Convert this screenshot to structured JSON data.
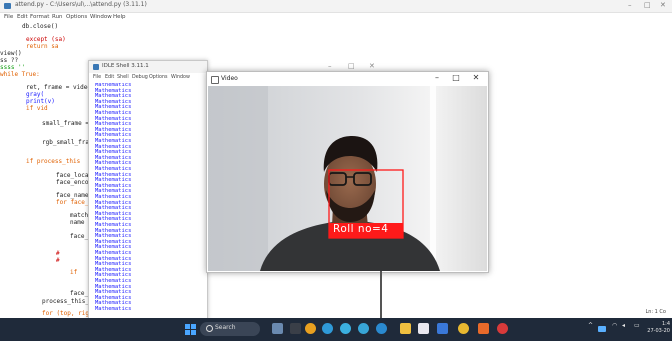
{
  "editor": {
    "title": "attend.py - C:\\Users\\ul\\...\\attend.py (3.11.1)",
    "menu": [
      "File",
      "Edit",
      "Format",
      "Run",
      "Options",
      "Window",
      "Help"
    ],
    "lines": [
      "db.close()",
      "",
      "except (sa)",
      "return sa",
      "view()",
      "ss ??",
      "ssss ''",
      "while True:",
      "",
      "ret, frame = video.read()",
      "gray(",
      "print(v)",
      "if vid",
      "",
      "small_frame = c",
      "",
      "rgb_small_fram",
      "",
      "if process_this",
      "",
      "face_locatio",
      "face_encodin",
      "",
      "face_names =",
      "for face_en",
      "",
      "matches",
      "name =",
      "",
      "face_d",
      "",
      "",
      "",
      "",
      "",
      "",
      "if ",
      "",
      "",
      "face_na",
      "process_this_f",
      "",
      "for (top, righ"
    ],
    "status": "Ln: 1 Co"
  },
  "shell": {
    "title": "IDLE Shell 3.11.1",
    "menu": [
      "File",
      "Edit",
      "Shell",
      "Debug",
      "Options",
      "Window"
    ],
    "output_line": "Mathematics",
    "line_count": 41
  },
  "video": {
    "title": "Video",
    "overlay_label": "Roll no=4",
    "box_color": "#ff1a1a"
  },
  "taskbar": {
    "search_label": "Search",
    "clock_time": "1:4",
    "clock_date": "27-03-20"
  },
  "icons": {
    "minimize": "minimize-icon",
    "maximize": "maximize-icon",
    "close": "close-icon"
  }
}
